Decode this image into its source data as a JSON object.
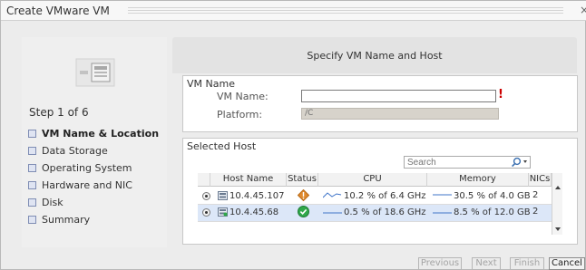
{
  "window": {
    "title": "Create VMware VM"
  },
  "wizard": {
    "step_count": "Step 1 of 6",
    "steps": [
      {
        "label": "VM Name & Location",
        "active": true
      },
      {
        "label": "Data Storage",
        "active": false
      },
      {
        "label": "Operating System",
        "active": false
      },
      {
        "label": "Hardware and NIC",
        "active": false
      },
      {
        "label": "Disk",
        "active": false
      },
      {
        "label": "Summary",
        "active": false
      }
    ]
  },
  "panel": {
    "heading": "Specify VM Name and Host"
  },
  "vm_name_section": {
    "legend": "VM Name",
    "name_label": "VM Name:",
    "name_value": "",
    "platform_label": "Platform:",
    "platform_value": "/C"
  },
  "host_section": {
    "legend": "Selected Host",
    "search_placeholder": "Search",
    "columns": [
      "Host Name",
      "Status",
      "CPU",
      "Memory",
      "NICs"
    ],
    "rows": [
      {
        "selected": false,
        "host": "10.4.45.107",
        "status": "warning",
        "cpu": "10.2 % of 6.4 GHz",
        "memory": "30.5 % of 4.0 GB",
        "nics": "2"
      },
      {
        "selected": true,
        "host": "10.4.45.68",
        "status": "ok",
        "cpu": "0.5 % of 18.6 GHz",
        "memory": "8.5 % of 12.0 GB",
        "nics": "2"
      }
    ]
  },
  "buttons": {
    "previous": "Previous",
    "next": "Next",
    "finish": "Finish",
    "cancel": "Cancel"
  },
  "colors": {
    "warning": "#e08a2e",
    "ok": "#2fa84a",
    "sparkline": "#3f74c9",
    "selected_row": "#dce7f8"
  }
}
